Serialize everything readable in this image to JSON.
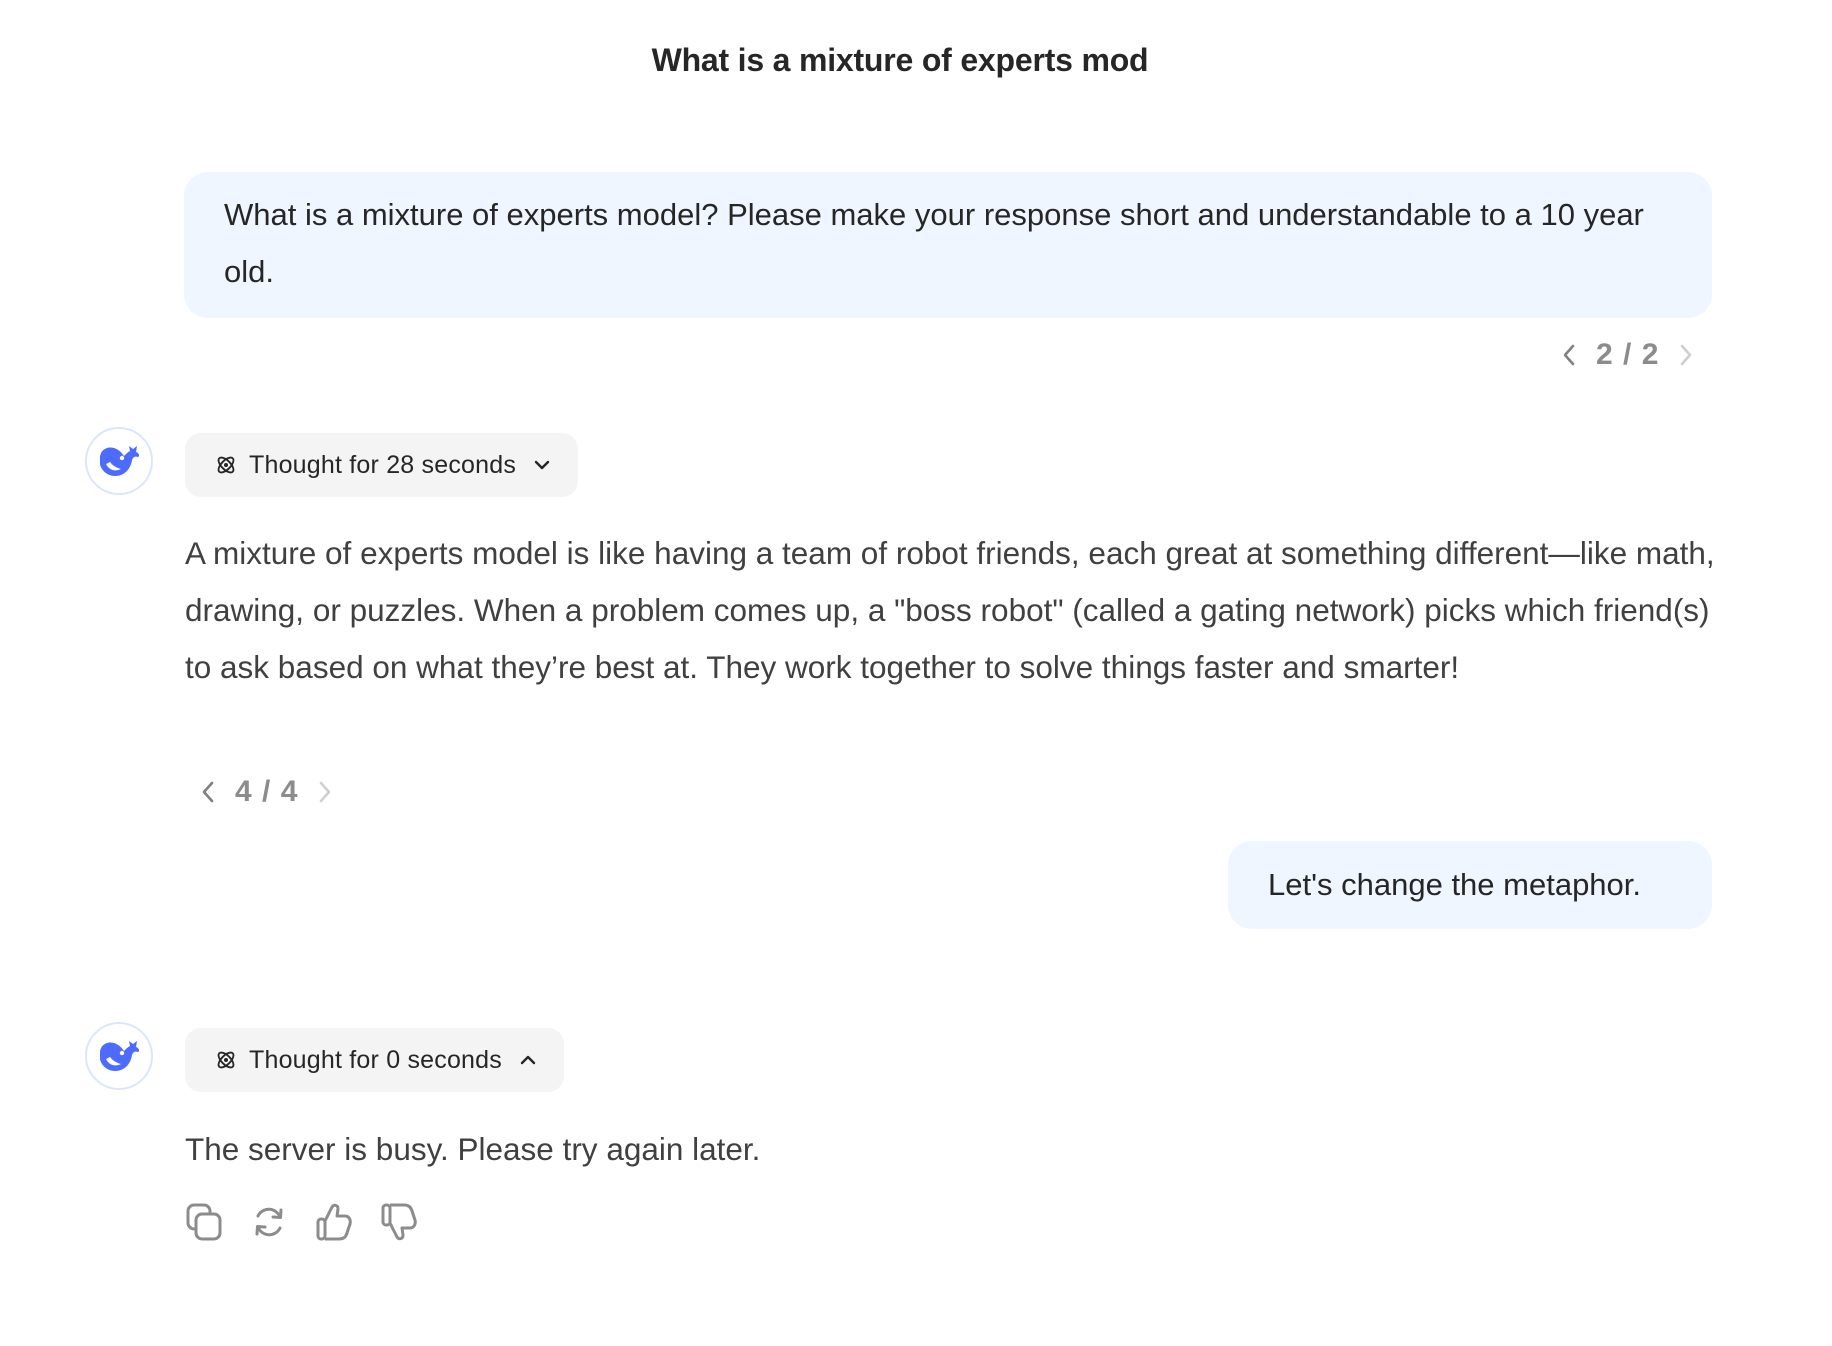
{
  "header": {
    "title": "What is a mixture of experts mod"
  },
  "colors": {
    "user_bubble_bg": "#eff6ff",
    "thought_pill_bg": "#f4f4f4",
    "brand_blue": "#4d6bfe",
    "muted_text": "#8c8c8c"
  },
  "conversation": {
    "message_1": {
      "role": "user",
      "text": "What is a mixture of experts model? Please make your response short and understandable to a 10 year old.",
      "pager": {
        "current": 2,
        "total": 2,
        "label": "2 / 2"
      }
    },
    "message_2": {
      "role": "assistant",
      "avatar_icon": "deepseek-whale-icon",
      "thought": {
        "label": "Thought for 28 seconds",
        "expanded": false,
        "icon": "atom-icon",
        "toggle_icon": "chevron-down-icon"
      },
      "text": "A mixture of experts model is like having a team of robot friends, each great at something different—like math, drawing, or puzzles. When a problem comes up, a \"boss robot\" (called a gating network) picks which friend(s) to ask based on what they’re best at. They work together to solve things faster and smarter!",
      "pager": {
        "current": 4,
        "total": 4,
        "label": "4 / 4"
      }
    },
    "message_3": {
      "role": "user",
      "text": "Let's change the metaphor."
    },
    "message_4": {
      "role": "assistant",
      "avatar_icon": "deepseek-whale-icon",
      "thought": {
        "label": "Thought for 0 seconds",
        "expanded": true,
        "icon": "atom-icon",
        "toggle_icon": "chevron-up-icon"
      },
      "text": "The server is busy. Please try again later.",
      "actions": [
        {
          "name": "copy",
          "icon": "copy-icon"
        },
        {
          "name": "regenerate",
          "icon": "refresh-icon"
        },
        {
          "name": "like",
          "icon": "thumbs-up-icon"
        },
        {
          "name": "dislike",
          "icon": "thumbs-down-icon"
        }
      ]
    }
  }
}
